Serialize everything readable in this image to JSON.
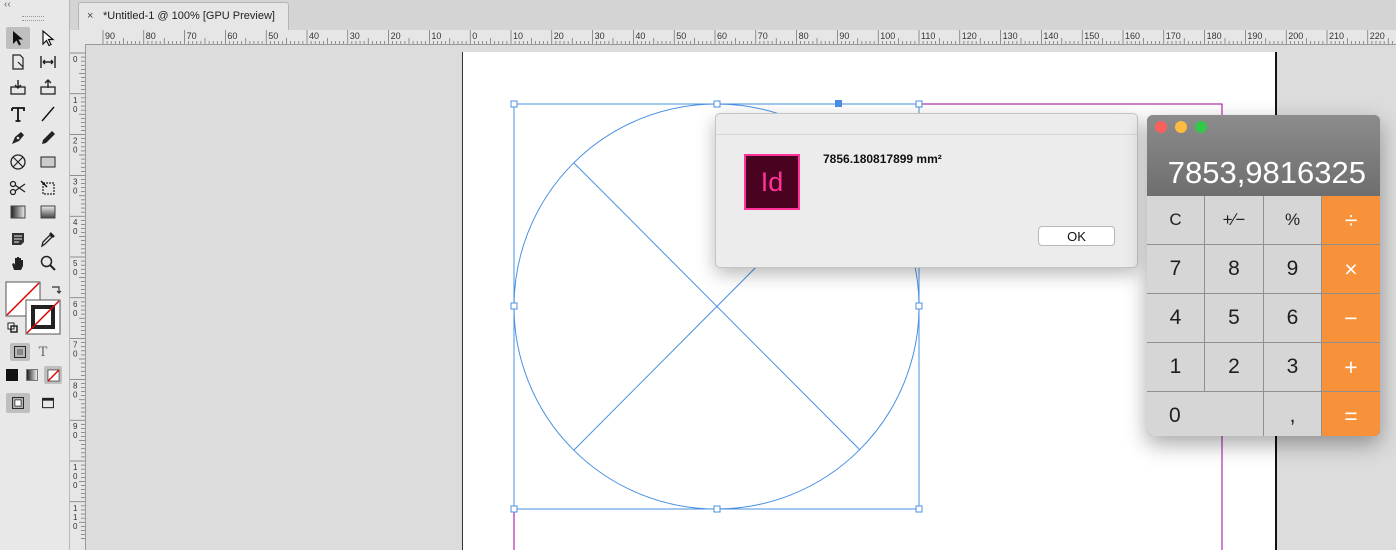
{
  "document_tab": {
    "close_glyph": "×",
    "title": "*Untitled-1 @ 100% [GPU Preview]"
  },
  "toolbar": {
    "collapse_glyph": "‹‹",
    "tools": [
      {
        "name": "selection-tool",
        "icon": "arrow-icon"
      },
      {
        "name": "direct-selection-tool",
        "icon": "hollow-arrow-icon"
      },
      {
        "name": "page-tool",
        "icon": "page-icon"
      },
      {
        "name": "gap-tool",
        "icon": "gap-icon"
      },
      {
        "name": "content-collector-tool",
        "icon": "collector-icon"
      },
      {
        "name": "content-placer-tool",
        "icon": "placer-icon"
      },
      {
        "name": "type-tool",
        "icon": "type-icon"
      },
      {
        "name": "line-tool",
        "icon": "line-icon"
      },
      {
        "name": "pen-tool",
        "icon": "pen-icon"
      },
      {
        "name": "pencil-tool",
        "icon": "pencil-icon"
      },
      {
        "name": "rectangle-frame-tool",
        "icon": "frame-icon"
      },
      {
        "name": "rectangle-tool",
        "icon": "rectangle-icon"
      },
      {
        "name": "scissors-tool",
        "icon": "scissors-icon"
      },
      {
        "name": "free-transform-tool",
        "icon": "transform-icon"
      },
      {
        "name": "gradient-swatch-tool",
        "icon": "gradient-icon"
      },
      {
        "name": "gradient-feather-tool",
        "icon": "feather-icon"
      },
      {
        "name": "note-tool",
        "icon": "note-icon"
      },
      {
        "name": "eyedropper-tool",
        "icon": "eyedropper-icon"
      },
      {
        "name": "hand-tool",
        "icon": "hand-icon"
      },
      {
        "name": "zoom-tool",
        "icon": "zoom-icon"
      }
    ],
    "formatting_text_glyph": "T"
  },
  "rulers": {
    "horizontal_ticks": [
      "90",
      "80",
      "70",
      "60",
      "50",
      "40",
      "30",
      "20",
      "10",
      "0",
      "10",
      "20",
      "30",
      "40",
      "50",
      "60",
      "70",
      "80",
      "90",
      "100",
      "110",
      "120",
      "130",
      "140",
      "150",
      "160",
      "170",
      "180",
      "190",
      "200",
      "210",
      "220"
    ],
    "vertical_ticks": [
      "0",
      "1 0",
      "2 0",
      "3 0",
      "4 0",
      "5 0",
      "6 0",
      "7 0",
      "8 0",
      "9 0",
      "1 0 0",
      "1 1 0"
    ]
  },
  "dialog": {
    "app_logo": "Id",
    "message": "7856.180817899 mm²",
    "ok_label": "OK"
  },
  "calculator": {
    "display": "7853,9816325",
    "colors": {
      "close": "#fc605c",
      "minimize": "#fdbc40",
      "zoom": "#34c84a",
      "operator": "#f7923a"
    },
    "keys": [
      {
        "label": "C",
        "type": "fn"
      },
      {
        "label": "+∕−",
        "type": "fn"
      },
      {
        "label": "%",
        "type": "fn"
      },
      {
        "label": "÷",
        "type": "op"
      },
      {
        "label": "7",
        "type": "num"
      },
      {
        "label": "8",
        "type": "num"
      },
      {
        "label": "9",
        "type": "num"
      },
      {
        "label": "×",
        "type": "op"
      },
      {
        "label": "4",
        "type": "num"
      },
      {
        "label": "5",
        "type": "num"
      },
      {
        "label": "6",
        "type": "num"
      },
      {
        "label": "−",
        "type": "op"
      },
      {
        "label": "1",
        "type": "num"
      },
      {
        "label": "2",
        "type": "num"
      },
      {
        "label": "3",
        "type": "num"
      },
      {
        "label": "+",
        "type": "op"
      },
      {
        "label": "0",
        "type": "zero"
      },
      {
        "label": ",",
        "type": "num"
      },
      {
        "label": "=",
        "type": "op"
      }
    ]
  }
}
